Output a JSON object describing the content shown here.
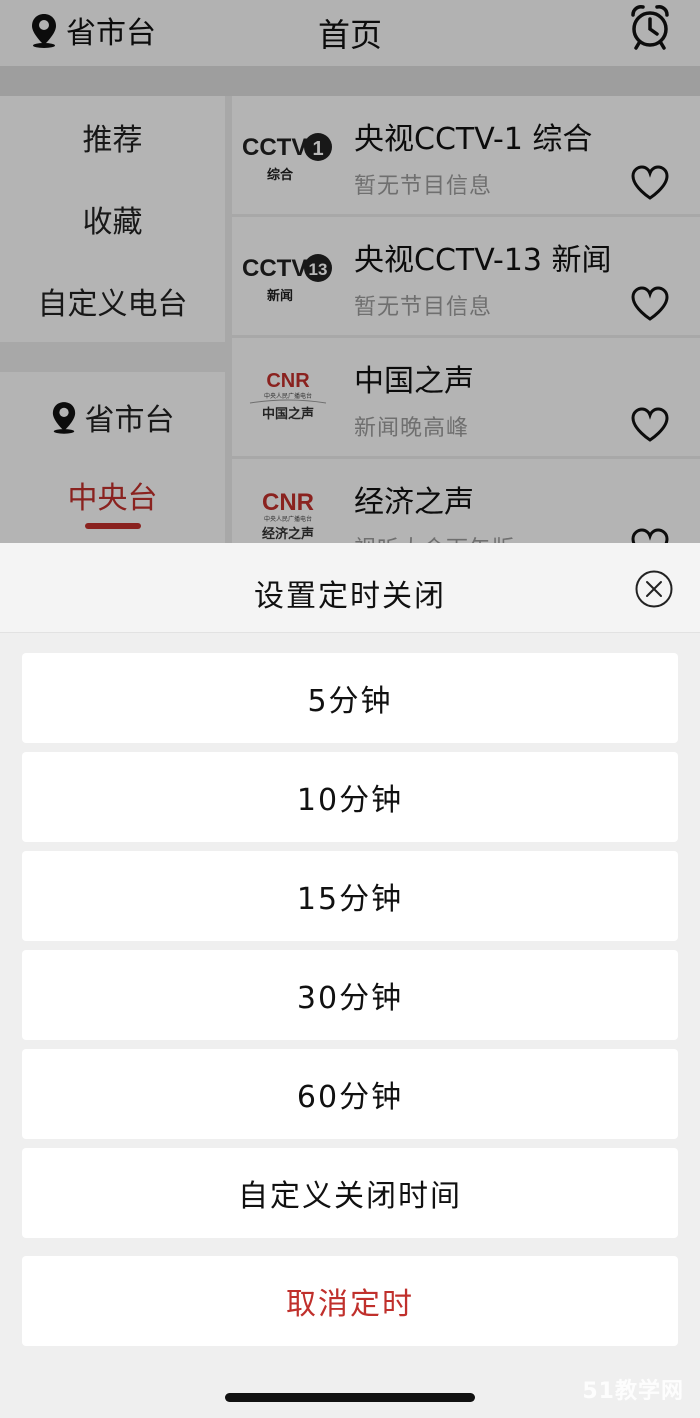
{
  "header": {
    "location_label": "省市台",
    "title": "首页",
    "icons": {
      "location": "location-pin-icon",
      "alarm": "alarm-clock-icon"
    }
  },
  "sidebar": {
    "categories": [
      {
        "label": "推荐"
      },
      {
        "label": "收藏"
      },
      {
        "label": "自定义电台"
      }
    ],
    "regions": {
      "province": "省市台",
      "central": "中央台"
    }
  },
  "stations": [
    {
      "name": "央视CCTV-1 综合",
      "program": "暂无节目信息",
      "logo_main": "CCTV",
      "logo_num": "1",
      "logo_sub": "综合"
    },
    {
      "name": "央视CCTV-13 新闻",
      "program": "暂无节目信息",
      "logo_main": "CCTV",
      "logo_num": "13",
      "logo_sub": "新闻"
    },
    {
      "name": "中国之声",
      "program": "新闻晚高峰",
      "logo_main": "CNR",
      "logo_small": "中央人民广播电台",
      "logo_sub": "中国之声"
    },
    {
      "name": "经济之声",
      "program": "视听大会下午版",
      "logo_main": "CNR",
      "logo_small": "中央人民广播电台",
      "logo_sub": "经济之声"
    }
  ],
  "timer_sheet": {
    "title": "设置定时关闭",
    "options": [
      {
        "label": "5分钟"
      },
      {
        "label": "10分钟"
      },
      {
        "label": "15分钟"
      },
      {
        "label": "30分钟"
      },
      {
        "label": "60分钟"
      },
      {
        "label": "自定义关闭时间"
      }
    ],
    "cancel_label": "取消定时"
  },
  "watermark": "51教学网",
  "colors": {
    "accent": "#c0302c",
    "sheet_bg": "#efefef",
    "option_bg": "#ffffff"
  }
}
